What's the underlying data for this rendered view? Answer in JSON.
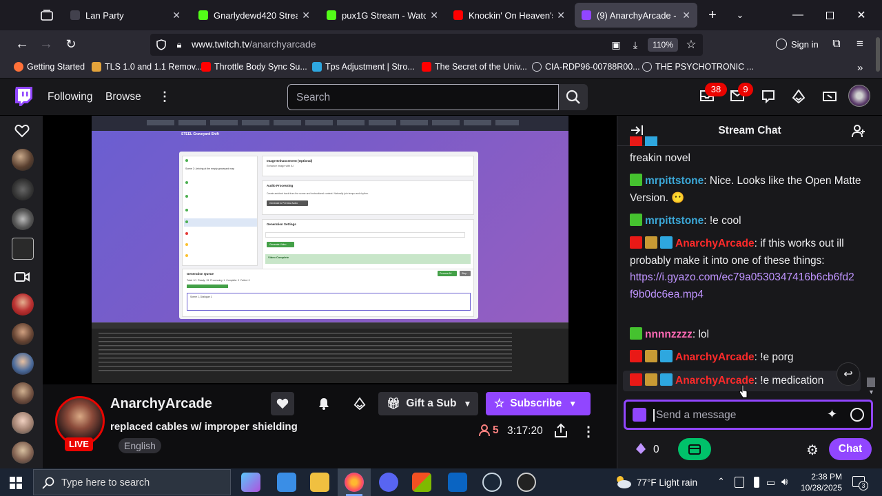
{
  "browser": {
    "tabs": [
      {
        "title": "Lan Party",
        "fav_color": "#cfcfd8"
      },
      {
        "title": "Gnarlydewd420 Stream",
        "fav_color": "#53fc18"
      },
      {
        "title": "pux1G Stream - Watch L",
        "fav_color": "#53fc18"
      },
      {
        "title": "Knockin' On Heaven's D",
        "fav_color": "#ff0000"
      },
      {
        "title": "(9) AnarchyArcade - Twi",
        "fav_color": "#9146ff"
      }
    ],
    "url_host": "www.twitch.tv",
    "url_path": "/anarchyarcade",
    "zoom": "110%",
    "sign_in": "Sign in",
    "bookmarks": [
      {
        "label": "Getting Started",
        "color": "#ff7139"
      },
      {
        "label": "TLS 1.0 and 1.1 Remov...",
        "color": "#e3a33b"
      },
      {
        "label": "Throttle Body Sync Su...",
        "color": "#ff0000"
      },
      {
        "label": "Tps Adjustment | Stro...",
        "color": "#2ea7df"
      },
      {
        "label": "The Secret of the Univ...",
        "color": "#ff0000"
      },
      {
        "label": "CIA-RDP96-00788R00...",
        "color": "#cfcfd8"
      },
      {
        "label": "THE PSYCHOTRONIC ...",
        "color": "#cfcfd8"
      }
    ]
  },
  "twitch": {
    "nav": {
      "following": "Following",
      "browse": "Browse",
      "search_placeholder": "Search",
      "inbox_count": "38",
      "notif_count": "9"
    },
    "channel": {
      "name": "AnarchyArcade",
      "title": "replaced cables w/ improper shielding",
      "tag": "English",
      "live": "LIVE",
      "viewers": "5",
      "uptime": "3:17:20",
      "gift": "Gift a Sub",
      "subscribe": "Subscribe"
    },
    "chat": {
      "header": "Stream Chat",
      "partial_top": "freakin novel",
      "messages": [
        {
          "user": "mrpittstone",
          "color": "#3ba8d8",
          "badges": [
            "green"
          ],
          "text": ": Nice. Looks like the Open Matte Version. 😶"
        },
        {
          "user": "mrpittstone",
          "color": "#3ba8d8",
          "badges": [
            "green"
          ],
          "text": ": !e cool"
        },
        {
          "user": "AnarchyArcade",
          "color": "#ff2a2a",
          "badges": [
            "red",
            "gift",
            "crown"
          ],
          "text": ": if this works out ill probably make it into one of these things:",
          "link": "https://i.gyazo.com/ec79a0530347416b6cb6fd2f9b0dc6ea.mp4"
        },
        {
          "user": "nnnnzzzz",
          "color": "#ff69b4",
          "badges": [
            "green"
          ],
          "text": ": lol"
        },
        {
          "user": "AnarchyArcade",
          "color": "#ff2a2a",
          "badges": [
            "red",
            "gift",
            "crown"
          ],
          "text": ": !e porg"
        },
        {
          "user": "AnarchyArcade",
          "color": "#ff2a2a",
          "badges": [
            "red",
            "gift",
            "crown"
          ],
          "text": ": !e medication"
        }
      ],
      "input_placeholder": "Send a message",
      "points": "0",
      "chat_button": "Chat"
    }
  },
  "video_frame": {
    "app_title": "STEEL Graveyard Shift",
    "image_enh": "Image Enhancement (Optional)",
    "enh_option": "Enhance image with AI",
    "audio": "Audio Processing",
    "audio_desc": "Create ambient track from the scene and instructional content. Naturally join tempo and rhythm.",
    "audio_btn": "Generate & Preview Audio",
    "gen_settings": "Generation Settings",
    "gen_btn": "Generate Video",
    "video_complete": "Video Complete",
    "queue": "Generation Queue",
    "queue_stats": [
      "Total: 1/1",
      "Ready: 13",
      "Processing: 1",
      "Complete: 0",
      "Failed: 0"
    ],
    "process_all": "Process All",
    "stop": "Stop",
    "scene_label": "Scene 2: Arriving at the empty graveyard map",
    "scene_item": "Scene 1, Dialogue 1"
  },
  "taskbar": {
    "search_placeholder": "Type here to search",
    "weather": "77°F  Light rain",
    "time": "2:38 PM",
    "date": "10/28/2025",
    "notif": "3"
  }
}
